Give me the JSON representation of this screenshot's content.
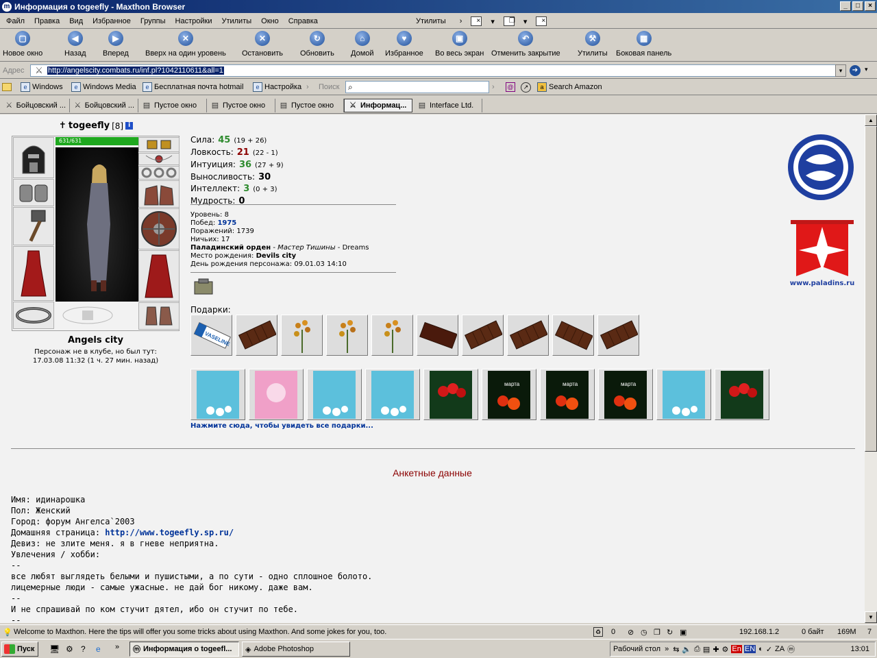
{
  "window": {
    "title": "Информация о togeefly - Maxthon Browser",
    "icon": "maxthon-icon",
    "min": "_",
    "max": "□",
    "close": "×"
  },
  "menu": {
    "items": [
      "Файл",
      "Правка",
      "Вид",
      "Избранное",
      "Группы",
      "Настройки",
      "Утилиты",
      "Окно",
      "Справка"
    ],
    "utilities_label": "Утилиты"
  },
  "toolbar": {
    "buttons": [
      {
        "label": "Новое окно",
        "icon": "new-window-icon"
      },
      {
        "label": "Назад",
        "icon": "back-arrow-icon"
      },
      {
        "label": "Вперед",
        "icon": "forward-arrow-icon"
      },
      {
        "label": "Вверх на один уровень",
        "icon": "up-level-icon"
      },
      {
        "label": "Остановить",
        "icon": "stop-icon"
      },
      {
        "label": "Обновить",
        "icon": "refresh-icon"
      },
      {
        "label": "Домой",
        "icon": "home-icon"
      },
      {
        "label": "Избранное",
        "icon": "favorites-icon"
      },
      {
        "label": "Во весь экран",
        "icon": "fullscreen-icon"
      },
      {
        "label": "Отменить закрытие",
        "icon": "undo-close-icon"
      },
      {
        "label": "Утилиты",
        "icon": "utilities-icon"
      },
      {
        "label": "Боковая панель",
        "icon": "sidebar-icon"
      }
    ]
  },
  "address": {
    "label": "Адрес",
    "url": "http://angelscity.combats.ru/inf.pl?1042110611&all=1"
  },
  "links": {
    "items": [
      "Windows",
      "Windows Media",
      "Бесплатная почта hotmail",
      "Настройка"
    ],
    "search_label": "Поиск",
    "amazon": "Search Amazon"
  },
  "tabs": [
    {
      "label": "Бойцовский ...",
      "active": false
    },
    {
      "label": "Бойцовский ...",
      "active": false
    },
    {
      "label": "Пустое окно",
      "active": false
    },
    {
      "label": "Пустое окно",
      "active": false
    },
    {
      "label": "Пустое окно",
      "active": false
    },
    {
      "label": "Информац...",
      "active": true
    },
    {
      "label": "Interface Ltd.",
      "active": false
    }
  ],
  "character": {
    "name": "togeefly",
    "level": "[8]",
    "hp": "631/631",
    "city": "Angels city",
    "presence_line1": "Персонаж не в клубе, но был тут:",
    "presence_line2": "17.03.08 11:32 (1 ч. 27 мин. назад)"
  },
  "stats": [
    {
      "label": "Сила:",
      "value": "45",
      "sub": "(19 + 26)",
      "color": "#2e8b2e"
    },
    {
      "label": "Ловкость:",
      "value": "21",
      "sub": "(22 - 1)",
      "color": "#8b0000"
    },
    {
      "label": "Интуиция:",
      "value": "36",
      "sub": "(27 + 9)",
      "color": "#2e8b2e"
    },
    {
      "label": "Выносливость:",
      "value": "30",
      "sub": "",
      "color": "#000000"
    },
    {
      "label": "Интеллект:",
      "value": "3",
      "sub": "(0 + 3)",
      "color": "#2e8b2e"
    },
    {
      "label": "Мудрость:",
      "value": "0",
      "sub": "",
      "color": "#000000"
    }
  ],
  "details": {
    "level": "Уровень: 8",
    "wins_label": "Побед:",
    "wins": "1975",
    "losses": "Поражений: 1739",
    "draws": "Ничьих: 17",
    "order": "Паладинский орден",
    "order_rank": "Мастер Тишины",
    "order_extra": "- Dreams",
    "birthplace_label": "Место рождения:",
    "birthplace": "Devils city",
    "birthday": "День рождения персонажа: 09.01.03 14:10"
  },
  "gifts": {
    "label": "Подарки:",
    "link": "Нажмите сюда, чтобы увидеть все подарки...",
    "row1": [
      "vaseline",
      "chocolate",
      "flowers",
      "flowers",
      "flowers",
      "chocolate",
      "chocolate",
      "chocolate",
      "chocolate",
      "chocolate"
    ],
    "row2": [
      "blue-card",
      "pink-card",
      "blue-card",
      "blue-card",
      "tulip-card",
      "tulip-card",
      "tulip-card",
      "tulip-card",
      "blue-card",
      "tulip-card"
    ],
    "vaseline_text": "VASELINE",
    "march_text": "марта"
  },
  "anketa": {
    "title": "Анкетные данные",
    "name": "Имя: идинарошка",
    "sex": "Пол: Женский",
    "city": "Город: форум Ангелса`2003",
    "homepage_label": "Домашняя страница: ",
    "homepage": "http://www.togeefly.sp.ru/",
    "motto": "Девиз: не злите меня. я в гневе неприятна.",
    "hobby": "Увлечения / хобби:",
    "lines": [
      "--",
      "все любят выглядеть белыми и пушистыми, а по сути - одно сплошное болото.",
      "лицемерные люди - самые ужасные. не дай бог никому. даже вам.",
      "--",
      "И не спрашивай по ком стучит дятел, ибо он стучит по тебе.",
      "--"
    ]
  },
  "paladins": {
    "url_text": "www.paladins.ru"
  },
  "status": {
    "tip": "Welcome to Maxthon. Here the tips will offer you some tricks about using Maxthon. And some jokes for you, too.",
    "count": "0",
    "ip": "192.168.1.2",
    "bytes": "0 байт",
    "mem": "169M",
    "num": "7"
  },
  "taskbar": {
    "start": "Пуск",
    "items": [
      {
        "label": "Информация о togeefl...",
        "pressed": true
      },
      {
        "label": "Adobe Photoshop",
        "pressed": false
      }
    ],
    "desktop": "Рабочий стол",
    "lang1": "En",
    "lang2": "EN",
    "time": "13:01"
  }
}
